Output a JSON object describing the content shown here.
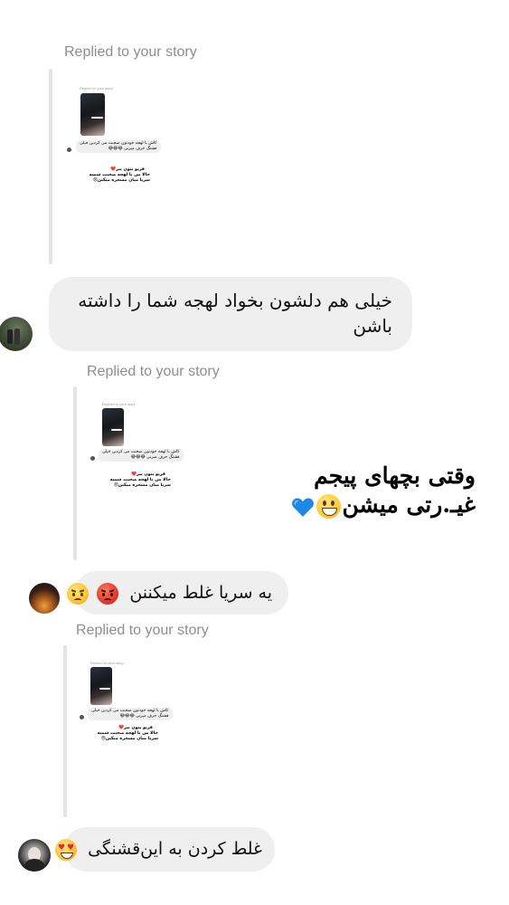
{
  "replies": [
    {
      "label": "Replied to your story",
      "story": {
        "mini_label": "Replied to your story",
        "bubble_line1": "کاش با لهجه خودتون صحبت می کردین خیلی",
        "bubble_line2": "قشنگ حرف میزنی 😂😂😂",
        "text_line1": "فریو بتون ببر❤️",
        "text_line2": "حالا من با لهجه صحبت شمیه",
        "text_line3": "سریا میان مسخره میکنن😢"
      },
      "message": "خیلی هم دلشون بخواد لهجه شما را داشته باشن"
    },
    {
      "label": "Replied to your story",
      "story": {
        "mini_label": "Replied to your story",
        "bubble_line1": "کاش با لهجه خودتون صحبت می کردین خیلی",
        "bubble_line2": "قشنگ حرف میزنی 😂😂😂",
        "text_line1": "فریو بتون ببر❤️",
        "text_line2": "حالا من با لهجه صحبت شمیه",
        "text_line3": "سریا میان مسخره میکنن😢"
      },
      "message": "یه سریا غلط میکننن"
    },
    {
      "label": "Replied to your story",
      "story": {
        "mini_label": "Replied to your story",
        "bubble_line1": "کاش با لهجه خودتون صحبت می کردین خیلی",
        "bubble_line2": "قشنگ حرف میزنی 😂😂😂",
        "text_line1": "فریو بتون ببر❤️",
        "text_line2": "حالا من با لهجه صحبت شمیه",
        "text_line3": "سریا میان مسخره میکنن😢"
      },
      "message": "غلط کردن به این‌قشنگی"
    }
  ],
  "overlay": {
    "line1": "وقتی بچهای پیجم",
    "line2": "غیـ.رتی میشن"
  },
  "icons": {
    "angry": "angry-face-icon",
    "pouting": "pouting-face-icon",
    "heart_eyes": "heart-eyes-face-icon",
    "grin": "grinning-face-icon",
    "blue_heart": "blue-heart-icon"
  },
  "colors": {
    "bubble": "#efefef",
    "meta_text": "#8e8e8e",
    "story_bar": "#e3e3e3",
    "blue_heart": "#1e88e5"
  }
}
